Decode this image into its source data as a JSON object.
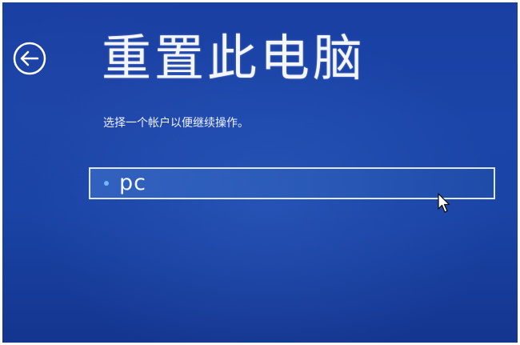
{
  "header": {
    "title": "重置此电脑",
    "back_icon": "arrow-left-circle-icon"
  },
  "instruction": "选择一个帐户以便继续操作。",
  "accounts": [
    {
      "name": "pc",
      "selected": true
    }
  ],
  "colors": {
    "background": "#1a44a6",
    "text": "#ffffff",
    "accent_dot": "#6fb8ff",
    "selection_border": "#dfe6ff"
  },
  "cursor_icon": "mouse-pointer-icon"
}
